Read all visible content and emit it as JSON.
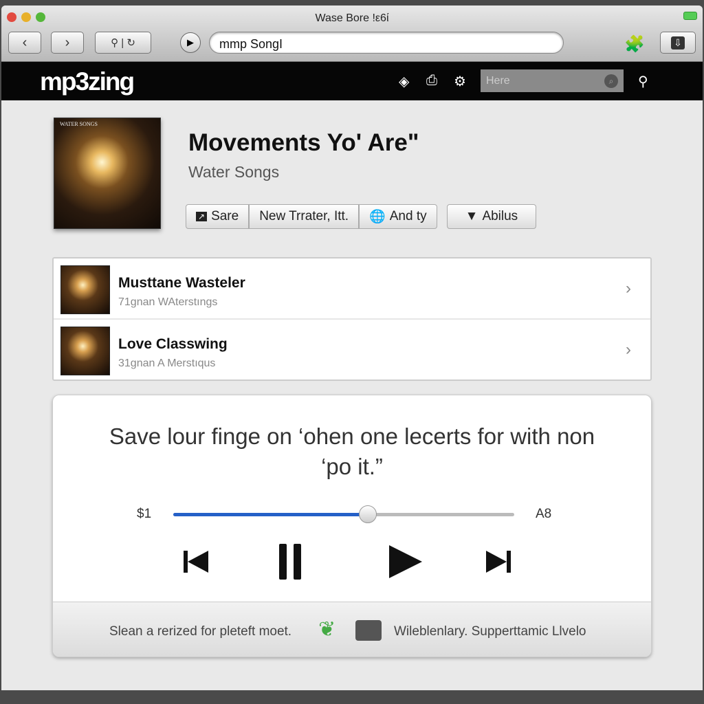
{
  "window": {
    "title": "Wase Bore !ε6ί",
    "url": "mmp SongI"
  },
  "nav": {
    "logo": "mp3zing",
    "search_placeholder": "Here"
  },
  "album": {
    "title": "Movements Yo' Are\"",
    "subtitle": "Water Songs",
    "cover_text": "WATER SONGS",
    "buttons": [
      {
        "label": "Sare",
        "icon": "share-icon"
      },
      {
        "label": "New Trrater, Itt."
      },
      {
        "label": "And ty",
        "icon": "globe-icon"
      },
      {
        "label": "Abilus",
        "icon": "trophy-icon"
      }
    ]
  },
  "tracks": [
    {
      "title": "Musttane Wasteler",
      "subtitle": "71gnan WAterstıngs"
    },
    {
      "title": "Love Classwing",
      "subtitle": "31gnan A Merstıqus"
    }
  ],
  "player": {
    "quote": "Save lour finge on ‘ohen one lecerts for with non ‘po it.”",
    "time_elapsed": "$1",
    "time_total": "A8",
    "progress_percent": 57,
    "accent": "#2560c8"
  },
  "footer": {
    "left_text": "Slean a rerized for pleteft moet.",
    "right_text": "Wileblenlary. Supperttamic Llvelo"
  }
}
